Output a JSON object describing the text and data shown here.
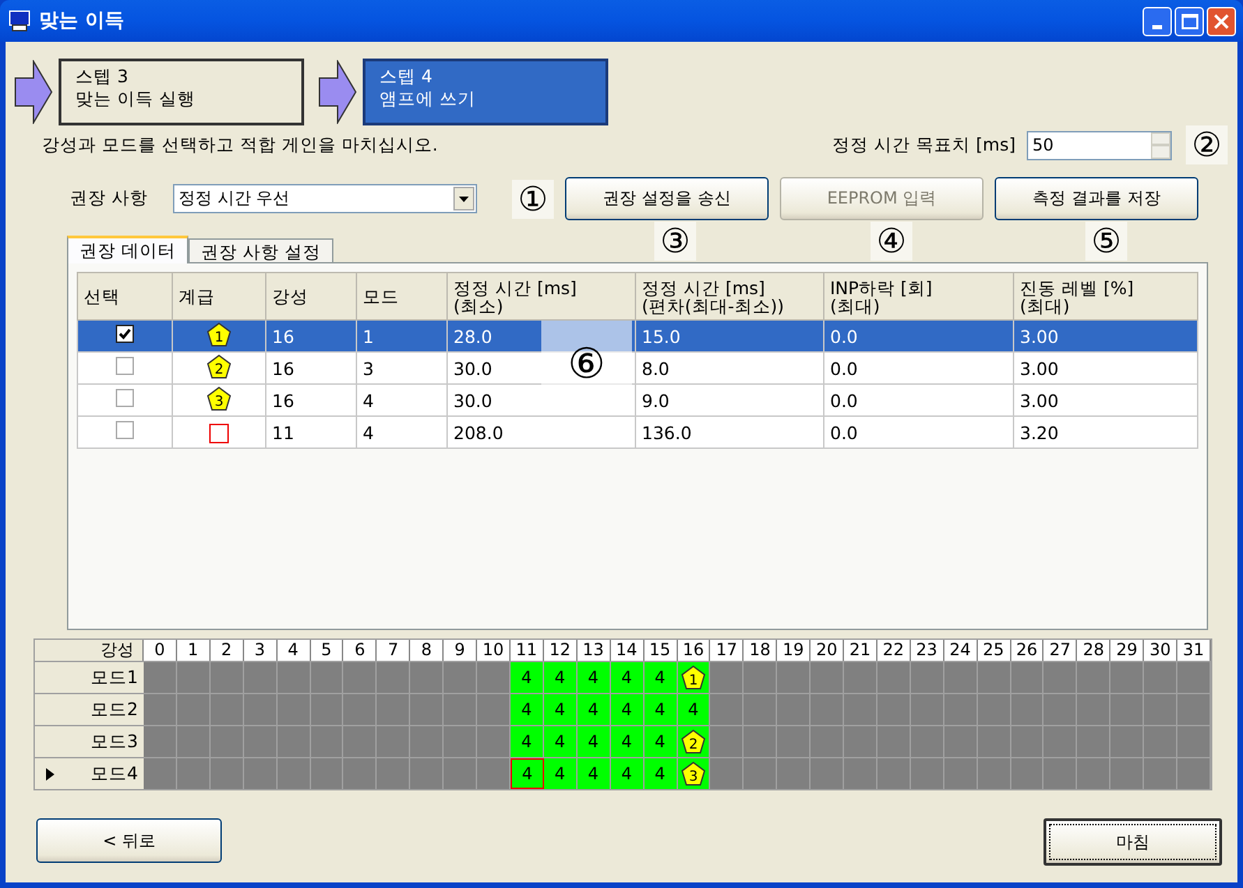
{
  "window": {
    "title": "맞는 이득"
  },
  "steps": [
    {
      "title": "스텝 3",
      "subtitle": "맞는 이득 실행",
      "active": false
    },
    {
      "title": "스텝 4",
      "subtitle": "앰프에 쓰기",
      "active": true
    }
  ],
  "instruction": "강성과 모드를 선택하고 적합 게인을 마치십시오.",
  "target": {
    "label": "정정 시간 목표치 [ms]",
    "value": "50"
  },
  "recommendation": {
    "label": "권장 사항",
    "value": "정정 시간 우선"
  },
  "buttons": [
    {
      "label": "권장 설정을 송신",
      "disabled": false
    },
    {
      "label": "EEPROM 입력",
      "disabled": true
    },
    {
      "label": "측정 결과를 저장",
      "disabled": false
    }
  ],
  "tabs": [
    {
      "label": "권장 데이터",
      "selected": true
    },
    {
      "label": "권장 사항 설정",
      "selected": false
    }
  ],
  "table": {
    "columns": [
      "선택",
      "계급",
      "강성",
      "모드",
      "정정 시간 [ms]\n(최소)",
      "정정 시간 [ms]\n(편차(최대-최소))",
      "INP하락 [회]\n(최대)",
      "진동 레벨 [%]\n(최대)"
    ],
    "rows": [
      {
        "selected": true,
        "checked": true,
        "rank": {
          "kind": "badge",
          "text": "1"
        },
        "cells": [
          "",
          "",
          "16",
          "1",
          "28.0",
          "15.0",
          "0.0",
          "3.00"
        ]
      },
      {
        "selected": false,
        "checked": false,
        "rank": {
          "kind": "badge",
          "text": "2"
        },
        "cells": [
          "",
          "",
          "16",
          "3",
          "30.0",
          "8.0",
          "0.0",
          "3.00"
        ]
      },
      {
        "selected": false,
        "checked": false,
        "rank": {
          "kind": "badge",
          "text": "3"
        },
        "cells": [
          "",
          "",
          "16",
          "4",
          "30.0",
          "9.0",
          "0.0",
          "3.00"
        ]
      },
      {
        "selected": false,
        "checked": false,
        "rank": {
          "kind": "square"
        },
        "cells": [
          "",
          "",
          "11",
          "4",
          "208.0",
          "136.0",
          "0.0",
          "3.20"
        ]
      }
    ]
  },
  "grid": {
    "corner": "강성",
    "columns": [
      "0",
      "1",
      "2",
      "3",
      "4",
      "5",
      "6",
      "7",
      "8",
      "9",
      "10",
      "11",
      "12",
      "13",
      "14",
      "15",
      "16",
      "17",
      "18",
      "19",
      "20",
      "21",
      "22",
      "23",
      "24",
      "25",
      "26",
      "27",
      "28",
      "29",
      "30",
      "31"
    ],
    "rows": [
      {
        "label": "모드1",
        "selected": false,
        "cells": [
          null,
          null,
          null,
          null,
          null,
          null,
          null,
          null,
          null,
          null,
          null,
          {
            "kind": "value",
            "text": "4",
            "selected": false
          },
          {
            "kind": "value",
            "text": "4",
            "selected": false
          },
          {
            "kind": "value",
            "text": "4",
            "selected": false
          },
          {
            "kind": "value",
            "text": "4",
            "selected": false
          },
          {
            "kind": "value",
            "text": "4",
            "selected": false
          },
          {
            "kind": "badge",
            "text": "1",
            "selected": false
          },
          null,
          null,
          null,
          null,
          null,
          null,
          null,
          null,
          null,
          null,
          null,
          null,
          null,
          null,
          null
        ]
      },
      {
        "label": "모드2",
        "selected": false,
        "cells": [
          null,
          null,
          null,
          null,
          null,
          null,
          null,
          null,
          null,
          null,
          null,
          {
            "kind": "value",
            "text": "4",
            "selected": false
          },
          {
            "kind": "value",
            "text": "4",
            "selected": false
          },
          {
            "kind": "value",
            "text": "4",
            "selected": false
          },
          {
            "kind": "value",
            "text": "4",
            "selected": false
          },
          {
            "kind": "value",
            "text": "4",
            "selected": false
          },
          {
            "kind": "value",
            "text": "4",
            "selected": false
          },
          null,
          null,
          null,
          null,
          null,
          null,
          null,
          null,
          null,
          null,
          null,
          null,
          null,
          null,
          null
        ]
      },
      {
        "label": "모드3",
        "selected": false,
        "cells": [
          null,
          null,
          null,
          null,
          null,
          null,
          null,
          null,
          null,
          null,
          null,
          {
            "kind": "value",
            "text": "4",
            "selected": false
          },
          {
            "kind": "value",
            "text": "4",
            "selected": false
          },
          {
            "kind": "value",
            "text": "4",
            "selected": false
          },
          {
            "kind": "value",
            "text": "4",
            "selected": false
          },
          {
            "kind": "value",
            "text": "4",
            "selected": false
          },
          {
            "kind": "badge",
            "text": "2",
            "selected": false
          },
          null,
          null,
          null,
          null,
          null,
          null,
          null,
          null,
          null,
          null,
          null,
          null,
          null,
          null,
          null
        ]
      },
      {
        "label": "모드4",
        "selected": true,
        "cells": [
          null,
          null,
          null,
          null,
          null,
          null,
          null,
          null,
          null,
          null,
          null,
          {
            "kind": "value",
            "text": "4",
            "selected": true
          },
          {
            "kind": "value",
            "text": "4",
            "selected": false
          },
          {
            "kind": "value",
            "text": "4",
            "selected": false
          },
          {
            "kind": "value",
            "text": "4",
            "selected": false
          },
          {
            "kind": "value",
            "text": "4",
            "selected": false
          },
          {
            "kind": "badge",
            "text": "3",
            "selected": false
          },
          null,
          null,
          null,
          null,
          null,
          null,
          null,
          null,
          null,
          null,
          null,
          null,
          null,
          null,
          null
        ]
      }
    ]
  },
  "back_button": {
    "label": "< 뒤로"
  },
  "finish_button": {
    "label": "마침",
    "focused": true
  },
  "callouts": [
    "①",
    "②",
    "③",
    "④",
    "⑤",
    "⑥"
  ]
}
